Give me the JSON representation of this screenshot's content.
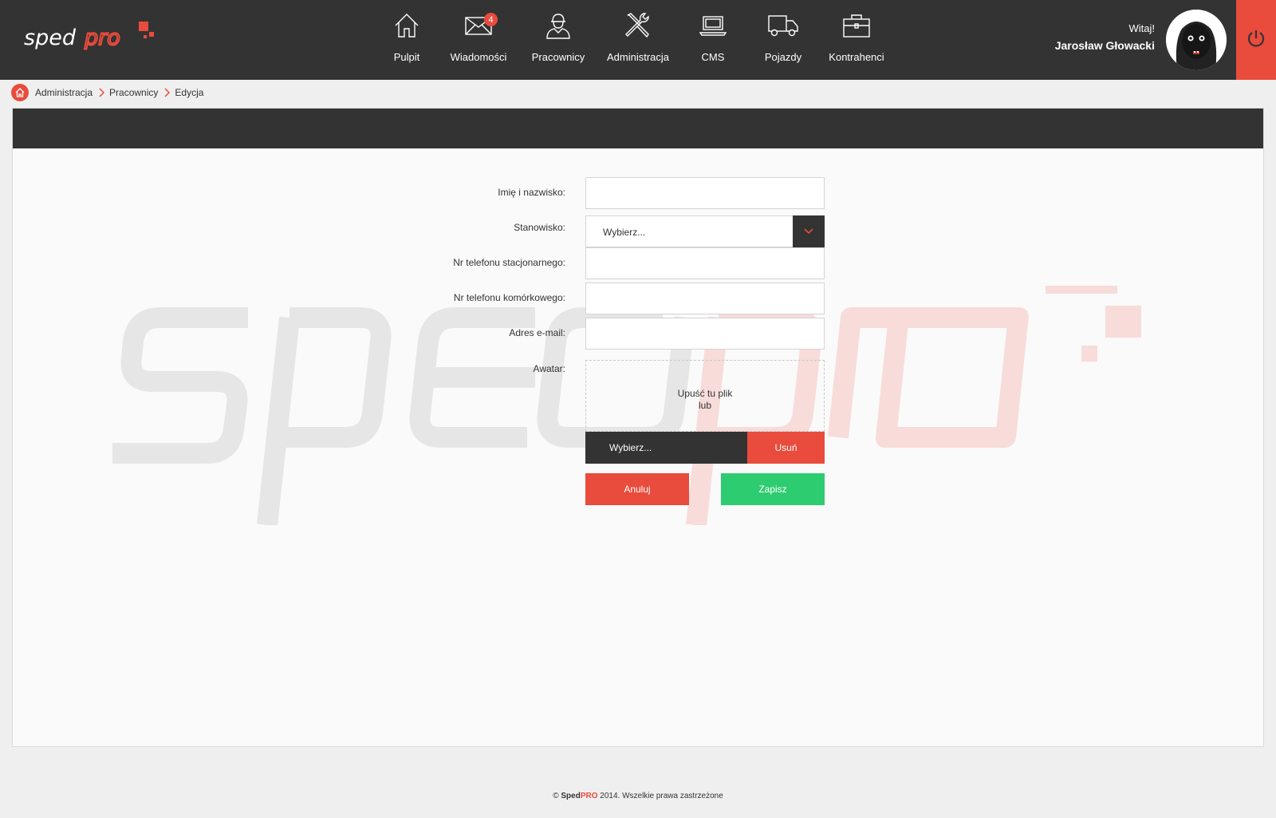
{
  "app": {
    "logo_text_sped": "sped",
    "logo_text_pro": "pro",
    "accent_color": "#e94b3c",
    "success_color": "#2ecc71",
    "dark_color": "#333333"
  },
  "nav": {
    "items": [
      {
        "label": "Pulpit",
        "icon": "home-icon"
      },
      {
        "label": "Wiadomości",
        "icon": "envelope-icon",
        "badge": "4"
      },
      {
        "label": "Pracownicy",
        "icon": "worker-icon"
      },
      {
        "label": "Administracja",
        "icon": "tools-icon"
      },
      {
        "label": "CMS",
        "icon": "laptop-icon"
      },
      {
        "label": "Pojazdy",
        "icon": "truck-icon"
      },
      {
        "label": "Kontrahenci",
        "icon": "briefcase-icon"
      }
    ]
  },
  "user": {
    "greeting": "Witaj!",
    "name": "Jarosław Głowacki",
    "avatar_icon": "avatar-icon",
    "logout_icon": "power-icon"
  },
  "breadcrumb": {
    "items": [
      "Administracja",
      "Pracownicy",
      "Edycja"
    ]
  },
  "form": {
    "name_label": "Imię i nazwisko:",
    "name_value": "",
    "position_label": "Stanowisko:",
    "position_value": "Wybierz...",
    "landline_label": "Nr telefonu stacjonarnego:",
    "landline_value": "",
    "mobile_label": "Nr telefonu komórkowego:",
    "mobile_value": "",
    "email_label": "Adres e-mail:",
    "email_value": "",
    "avatar_label": "Awatar:",
    "dropzone_line1": "Upuść tu plik",
    "dropzone_line2": "lub",
    "choose_file_label": "Wybierz...",
    "remove_file_label": "Usuń",
    "cancel_label": "Anuluj",
    "save_label": "Zapisz"
  },
  "footer": {
    "prefix": "© ",
    "brand_sped": "Sped",
    "brand_pro": "PRO",
    "suffix": " 2014. Wszelkie prawa zastrzeżone"
  }
}
